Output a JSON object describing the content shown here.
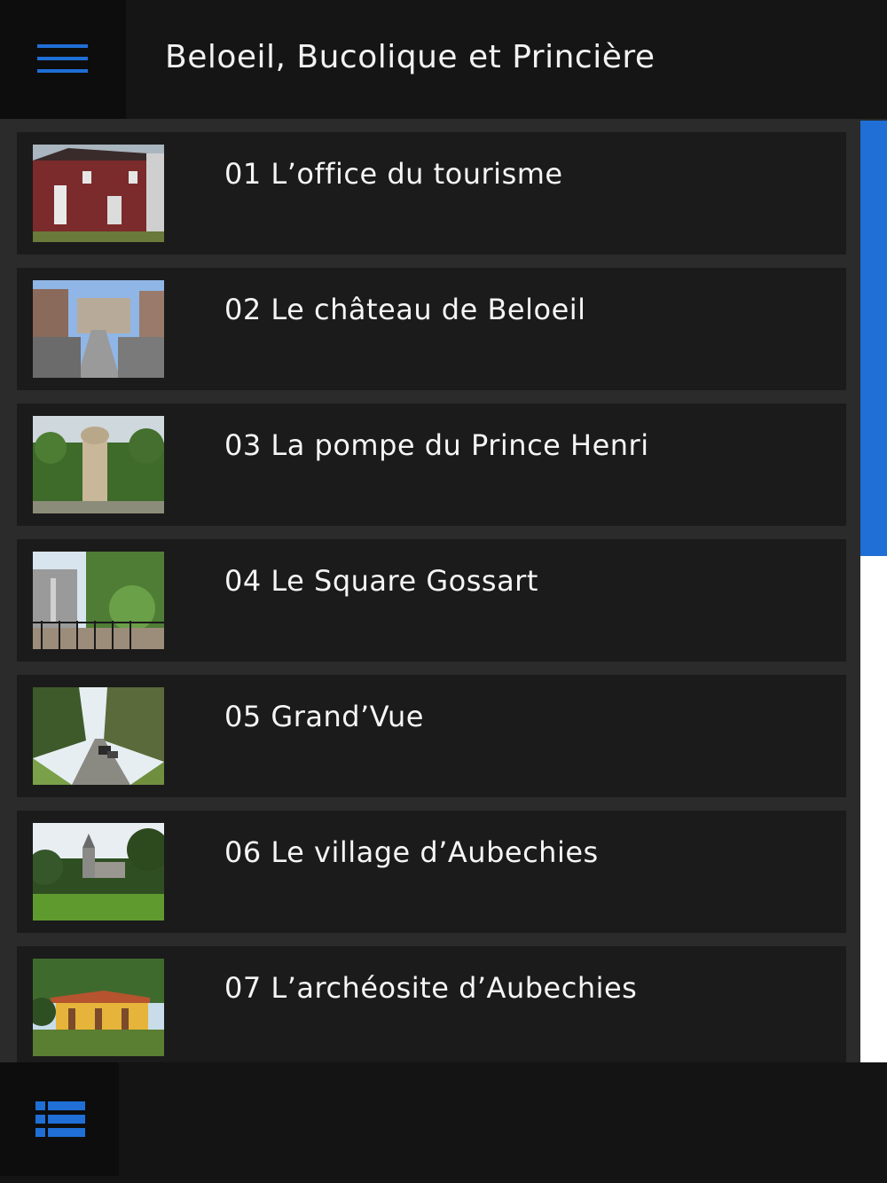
{
  "app": {
    "title": "Beloeil, Bucolique et Princière",
    "accent_color": "#1f6fd6"
  },
  "header": {
    "menu_icon": "hamburger-menu-icon"
  },
  "list": {
    "items": [
      {
        "label": "01 L’office du tourisme",
        "thumbnail": "red-brick-building-photo"
      },
      {
        "label": "02 Le château de Beloeil",
        "thumbnail": "castle-bridge-photo"
      },
      {
        "label": "03 La pompe du Prince Henri",
        "thumbnail": "stone-pump-photo"
      },
      {
        "label": "04 Le Square Gossart",
        "thumbnail": "square-gate-trees-photo"
      },
      {
        "label": "05 Grand’Vue",
        "thumbnail": "forest-road-cars-photo"
      },
      {
        "label": "06 Le village d’Aubechies",
        "thumbnail": "village-church-field-photo"
      },
      {
        "label": "07 L’archéosite d’Aubechies",
        "thumbnail": "yellow-roman-house-photo"
      }
    ]
  },
  "scrollbar": {
    "position_fraction": 0.0,
    "visible_fraction": 0.46
  },
  "footer": {
    "list_icon": "list-view-icon"
  }
}
